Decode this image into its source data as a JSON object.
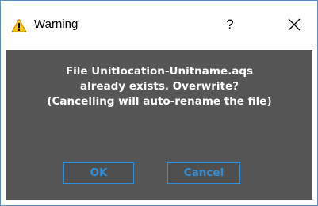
{
  "window": {
    "title": "Warning",
    "help_glyph": "?",
    "icons": {
      "title_icon": "warning-triangle-icon",
      "close_icon": "close-icon"
    }
  },
  "message": {
    "lines": [
      "File Unitlocation-Unitname.aqs",
      "already exists. Overwrite?",
      "(Cancelling will auto-rename the file)"
    ]
  },
  "buttons": {
    "ok_label": "OK",
    "cancel_label": "Cancel"
  },
  "colors": {
    "content_background": "#565656",
    "message_text": "#ffffff",
    "button_accent": "#2f8fd6",
    "button_background": "#4f4f4f",
    "warning_yellow": "#f5c400",
    "window_border": "#5a8fc6"
  }
}
